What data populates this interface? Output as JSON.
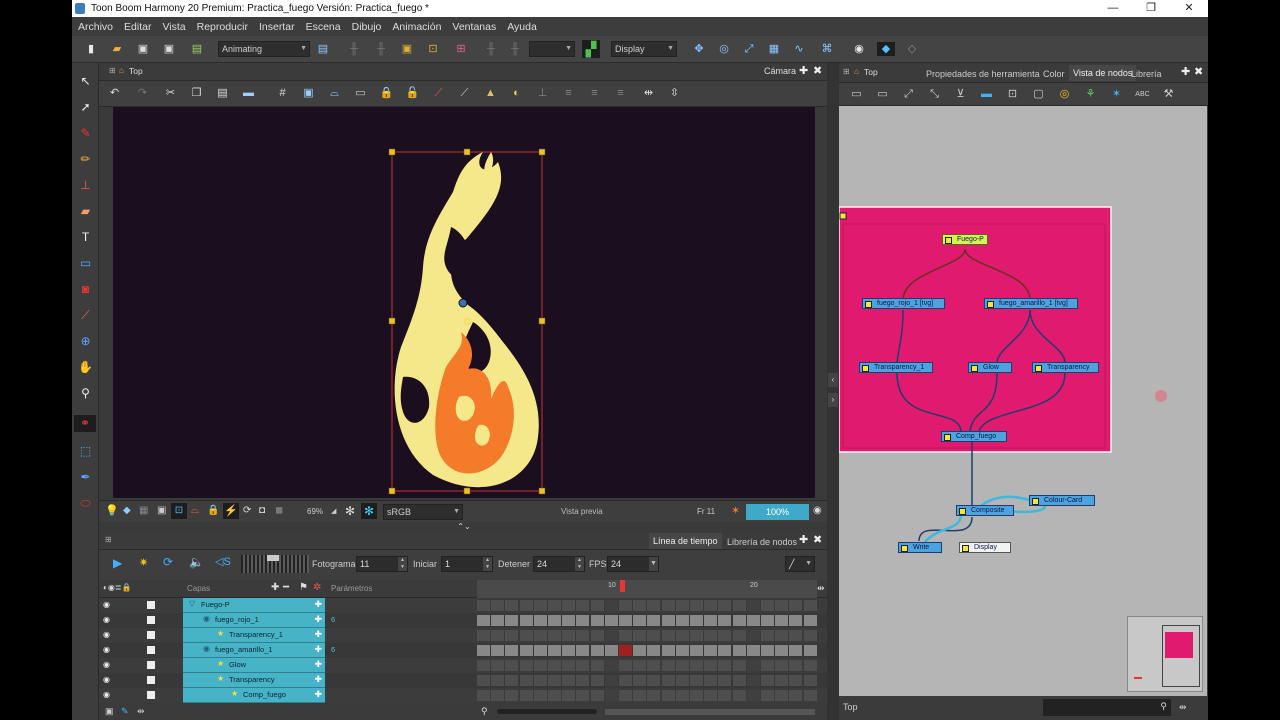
{
  "window": {
    "title": "Toon Boom Harmony 20 Premium: Practica_fuego Versión: Practica_fuego *",
    "controls": {
      "minimize": "—",
      "maximize": "❐",
      "close": "✕"
    }
  },
  "menu": [
    "Archivo",
    "Editar",
    "Vista",
    "Reproducir",
    "Insertar",
    "Escena",
    "Dibujo",
    "Animación",
    "Ventanas",
    "Ayuda"
  ],
  "toolbar": {
    "workspace": "Animating",
    "display": "Display"
  },
  "camera_panel": {
    "breadcrumb": "Top",
    "title": "Cámara",
    "zoom": "69%",
    "color_space": "sRGB",
    "preview_label": "Vista previa",
    "frame_label": "Fr 11",
    "percent": "100%"
  },
  "node_panel": {
    "breadcrumb": "Top",
    "tabs": [
      "Propiedades de herramienta",
      "Color",
      "Vista de nodos",
      "Librería"
    ],
    "active_tab": "Vista de nodos",
    "group_color": "#e01a6e",
    "nodes": {
      "fuego_p": "Fuego-P",
      "fuego_rojo": "fuego_rojo_1 [tvg]",
      "fuego_amarillo": "fuego_amarillo_1 [tvg]",
      "transparency_1": "Transparency_1",
      "glow": "Glow",
      "transparency": "Transparency",
      "comp_fuego": "Comp_fuego",
      "composite": "Composite",
      "colour_card": "Colour-Card",
      "write": "Write",
      "display": "Display"
    },
    "status_label": "Top"
  },
  "timeline": {
    "tabs": [
      "Línea de tiempo",
      "Librería de nodos"
    ],
    "active_tab": "Línea de tiempo",
    "fotograma_label": "Fotograma",
    "fotograma_value": "11",
    "iniciar_label": "Iniciar",
    "iniciar_value": "1",
    "detener_label": "Detener",
    "detener_value": "24",
    "fps_label": "FPS",
    "fps_value": "24",
    "capas_label": "Capas",
    "parametros_label": "Parámetros",
    "ruler_marks": [
      "10",
      "20"
    ],
    "current_frame": 11,
    "layers": [
      {
        "name": "Fuego-P",
        "indent": 0,
        "param": ""
      },
      {
        "name": "fuego_rojo_1",
        "indent": 1,
        "param": "6"
      },
      {
        "name": "Transparency_1",
        "indent": 2,
        "param": ""
      },
      {
        "name": "fuego_amarillo_1",
        "indent": 1,
        "param": "6"
      },
      {
        "name": "Glow",
        "indent": 2,
        "param": ""
      },
      {
        "name": "Transparency",
        "indent": 2,
        "param": ""
      },
      {
        "name": "Comp_fuego",
        "indent": 3,
        "param": ""
      }
    ]
  },
  "colors": {
    "accent": "#46b3c6",
    "canvas_bg": "#1b0e1e",
    "flame_yellow": "#f4e88a",
    "flame_orange": "#f47b2a",
    "selection": "#f0c020"
  }
}
